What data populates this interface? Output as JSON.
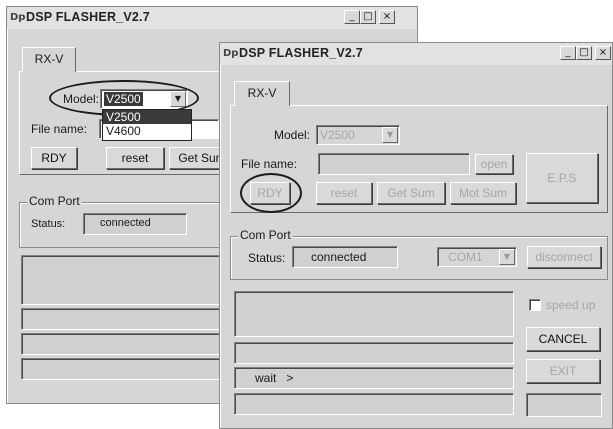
{
  "back_window": {
    "title": "DSP FLASHER_V2.7",
    "icon_glyph": "Dp",
    "caption": {
      "minimize": "_",
      "maximize": "□",
      "close": "×"
    },
    "tab_label": "RX-V",
    "model_label": "Model:",
    "model_value": "V2500",
    "model_options": [
      "V2500",
      "V4600"
    ],
    "model_selected_index": 0,
    "file_name_label": "File name:",
    "buttons": {
      "rdy": "RDY",
      "reset": "reset",
      "get_sum": "Get Sum"
    },
    "com_port_title": "Com Port",
    "status_label": "Status:",
    "status_value": "connected"
  },
  "front_window": {
    "title": "DSP FLASHER_V2.7",
    "icon_glyph": "Dp",
    "caption": {
      "minimize": "_",
      "maximize": "□",
      "close": "×"
    },
    "tab_label": "RX-V",
    "model_label": "Model:",
    "model_value": "V2500",
    "file_name_label": "File name:",
    "file_name_value": "",
    "buttons": {
      "open": "open",
      "eps": "E.P.S",
      "rdy": "RDY",
      "reset": "reset",
      "get_sum": "Get Sum",
      "mot_sum": "Mot Sum",
      "disconnect": "disconnect",
      "cancel": "CANCEL",
      "exit": "EXIT"
    },
    "com_port_title": "Com Port",
    "status_label": "Status:",
    "status_value": "connected",
    "port_value": "COM1",
    "speed_up_label": "speed up",
    "speed_up_checked": false,
    "log_line": "wait   >"
  },
  "icons": {
    "dropdown_arrow": "▼"
  },
  "colors": {
    "window_bg": "#d6d6d6",
    "selected_bg": "#3a3a3a",
    "disabled_text": "#a6a6a6"
  }
}
